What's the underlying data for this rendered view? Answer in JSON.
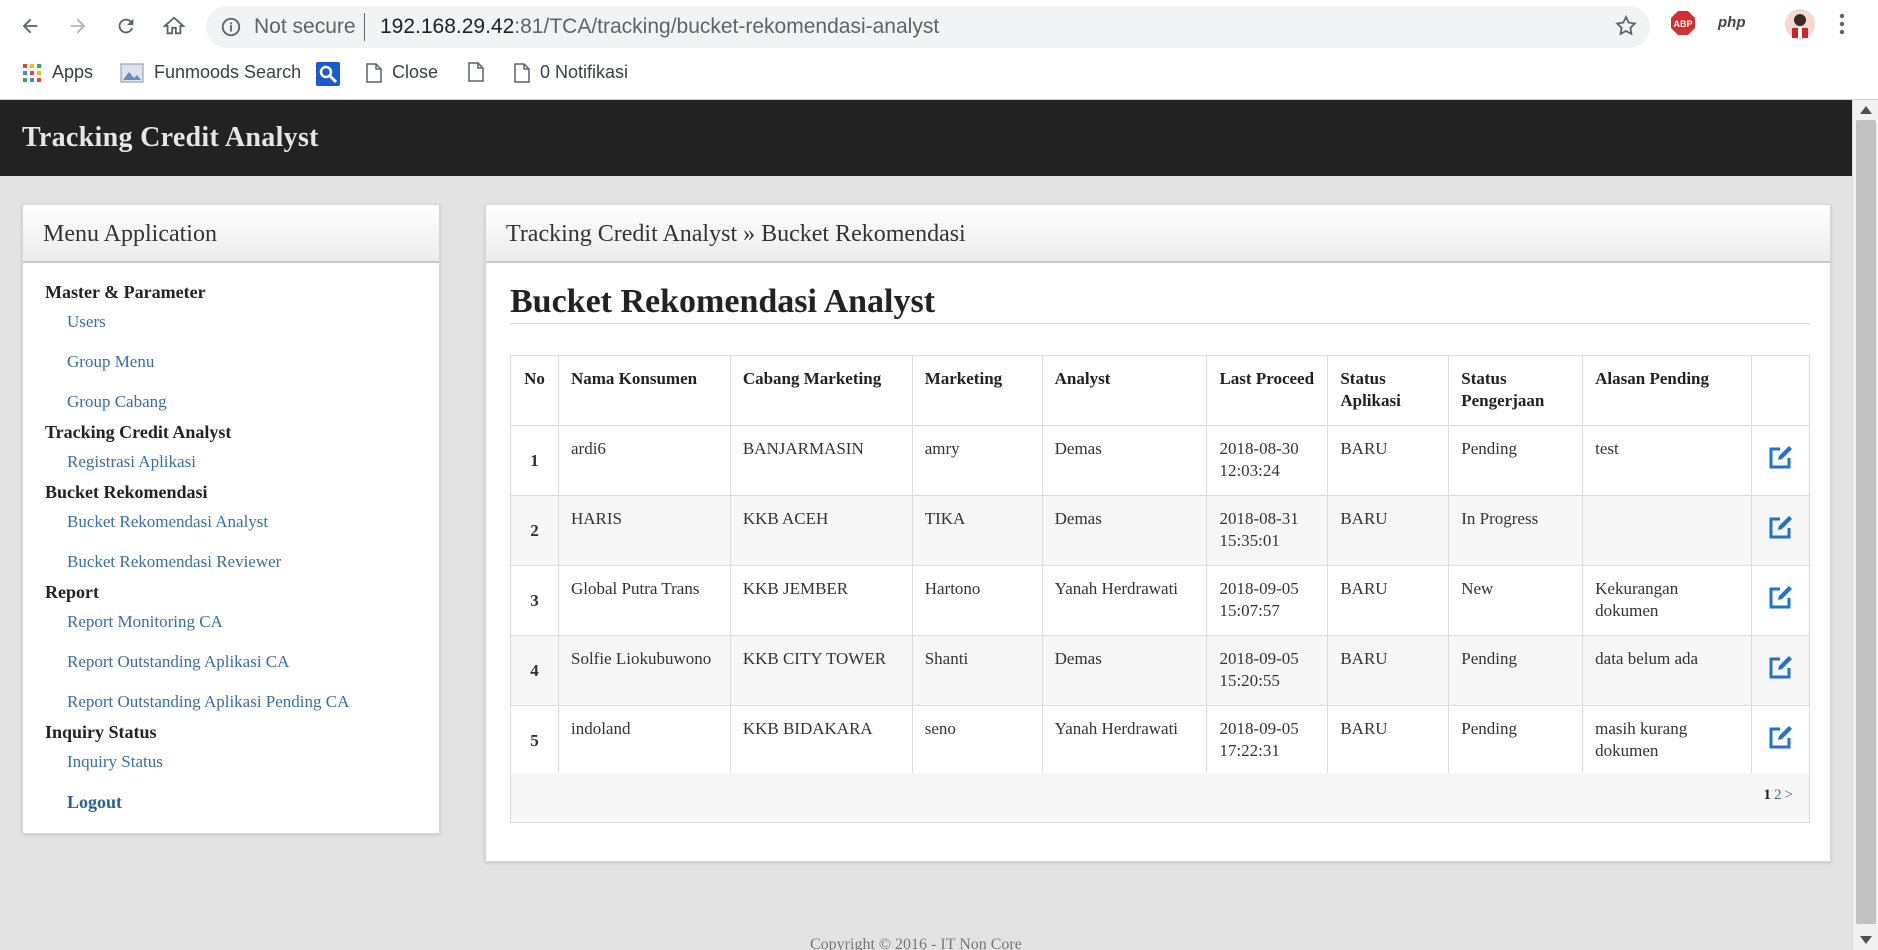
{
  "browser": {
    "security": "Not secure",
    "url_host": "192.168.29.42",
    "url_rest": ":81/TCA/tracking/bucket-rekomendasi-analyst",
    "bookmarks": [
      "Apps",
      "Funmoods Search",
      "Close",
      "0 Notifikasi"
    ],
    "ext_php": "php",
    "ext_abp": "ABP"
  },
  "app": {
    "title": "Tracking Credit Analyst"
  },
  "sidebar": {
    "title": "Menu Application",
    "groups": [
      {
        "label": "Master & Parameter",
        "items": [
          "Users",
          "Group Menu",
          "Group Cabang"
        ]
      },
      {
        "label": "Tracking Credit Analyst",
        "items": [
          "Registrasi Aplikasi"
        ]
      },
      {
        "label": "Bucket Rekomendasi",
        "items": [
          "Bucket Rekomendasi Analyst",
          "Bucket Rekomendasi Reviewer"
        ]
      },
      {
        "label": "Report",
        "items": [
          "Report Monitoring CA",
          "Report Outstanding Aplikasi CA",
          "Report Outstanding Aplikasi Pending CA"
        ]
      },
      {
        "label": "Inquiry Status",
        "items": [
          "Inquiry Status"
        ]
      }
    ],
    "logout": "Logout"
  },
  "main": {
    "breadcrumb": "Tracking Credit Analyst » Bucket Rekomendasi",
    "heading": "Bucket Rekomendasi Analyst",
    "columns": [
      "No",
      "Nama Konsumen",
      "Cabang Marketing",
      "Marketing",
      "Analyst",
      "Last Proceed",
      "Status Aplikasi",
      "Status Pengerjaan",
      "Alasan Pending"
    ],
    "rows": [
      {
        "no": "1",
        "nama": "ardi6",
        "cabang": "BANJARMASIN",
        "marketing": "amry",
        "analyst": "Demas",
        "last": "2018-08-30 12:03:24",
        "status_app": "BARU",
        "status_kerja": "Pending",
        "alasan": "test"
      },
      {
        "no": "2",
        "nama": "HARIS",
        "cabang": "KKB ACEH",
        "marketing": "TIKA",
        "analyst": "Demas",
        "last": "2018-08-31 15:35:01",
        "status_app": "BARU",
        "status_kerja": "In Progress",
        "alasan": ""
      },
      {
        "no": "3",
        "nama": "Global Putra Trans",
        "cabang": "KKB JEMBER",
        "marketing": "Hartono",
        "analyst": "Yanah Herdrawati",
        "last": "2018-09-05 15:07:57",
        "status_app": "BARU",
        "status_kerja": "New",
        "alasan": "Kekurangan dokumen"
      },
      {
        "no": "4",
        "nama": "Solfie Liokubuwono",
        "cabang": "KKB CITY TOWER",
        "marketing": "Shanti",
        "analyst": "Demas",
        "last": "2018-09-05 15:20:55",
        "status_app": "BARU",
        "status_kerja": "Pending",
        "alasan": "data belum ada"
      },
      {
        "no": "5",
        "nama": "indoland",
        "cabang": "KKB BIDAKARA",
        "marketing": "seno",
        "analyst": "Yanah Herdrawati",
        "last": "2018-09-05 17:22:31",
        "status_app": "BARU",
        "status_kerja": "Pending",
        "alasan": "masih kurang dokumen"
      }
    ],
    "pager": {
      "current": "1",
      "next_page": "2",
      "next_arrow": ">"
    }
  },
  "footer": {
    "copyright": "Copyright © 2016 - IT Non Core"
  },
  "colors": {
    "header_bg": "#222222",
    "link": "#3a6ea5",
    "edit_icon": "#1f73c9"
  }
}
